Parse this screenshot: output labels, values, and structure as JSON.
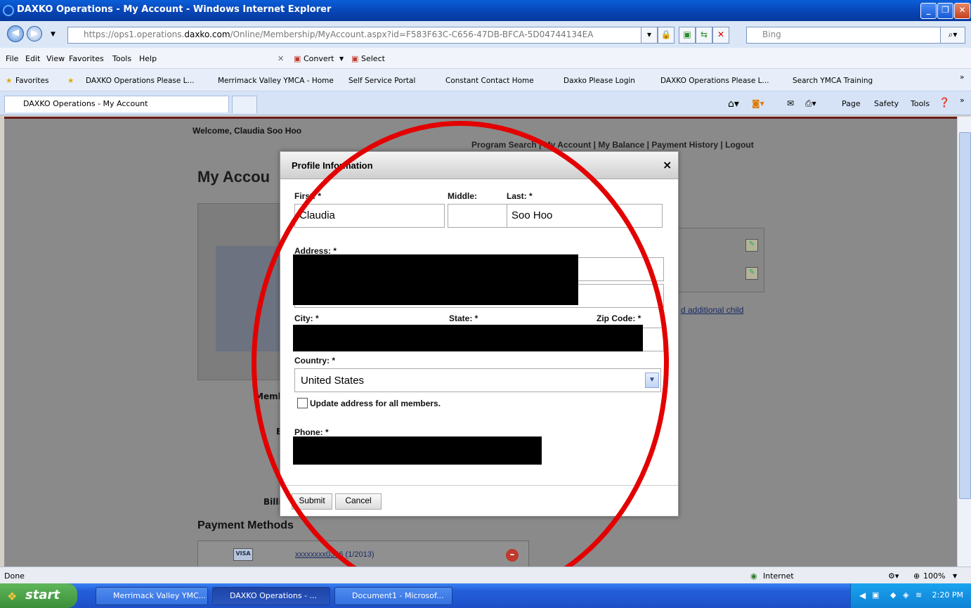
{
  "window": {
    "title": "DAXKO Operations - My Account - Windows Internet Explorer"
  },
  "address_bar": {
    "url_prefix": "https://ops1.operations.",
    "url_domain": "daxko.com",
    "url_path": "/Online/Membership/MyAccount.aspx?id=F583F63C-C656-47DB-BFCA-5D04744134EA",
    "search_placeholder": "Bing"
  },
  "menu": {
    "items": [
      "File",
      "Edit",
      "View",
      "Favorites",
      "Tools",
      "Help"
    ],
    "convert": "Convert",
    "select": "Select"
  },
  "favorites": {
    "label": "Favorites",
    "items": [
      "DAXKO Operations Please L...",
      "Merrimack Valley YMCA - Home",
      "Self Service Portal",
      "Constant Contact Home",
      "Daxko Please Login",
      "DAXKO Operations Please L...",
      "Search YMCA Training"
    ]
  },
  "tabs": {
    "active": "DAXKO Operations - My Account",
    "tools": [
      "Page",
      "Safety",
      "Tools"
    ]
  },
  "page": {
    "welcome": "Welcome, Claudia Soo Hoo",
    "top_links": "Program Search | My Account | My Balance | Payment History | Logout",
    "heading": "My Accou",
    "add_child": "d additional child",
    "payment_methods": "Payment Methods",
    "card_link": "xxxxxxxx0346",
    "card_exp": "(1/2013)",
    "side_labels": [
      "Membe",
      "B",
      "Billi"
    ]
  },
  "modal": {
    "title": "Profile Information",
    "close": "×",
    "labels": {
      "first": "First: *",
      "middle": "Middle:",
      "last": "Last: *",
      "address": "Address: *",
      "city": "City: *",
      "state": "State: *",
      "zip": "Zip Code: *",
      "country": "Country: *",
      "update_all": "Update address for all members.",
      "phone": "Phone: *"
    },
    "values": {
      "first": "Claudia",
      "middle": "",
      "last": "Soo Hoo",
      "country": "United States"
    },
    "submit": "Submit",
    "cancel": "Cancel"
  },
  "statusbar": {
    "status": "Done",
    "zone": "Internet",
    "zoom": "100%"
  },
  "taskbar": {
    "start": "start",
    "tasks": [
      "Merrimack Valley YMC...",
      "DAXKO Operations - ...",
      "Document1 - Microsof..."
    ],
    "clock": "2:20 PM"
  },
  "colors": {
    "annotation_circle": "#e30000",
    "title_bar": "#0846b8"
  }
}
